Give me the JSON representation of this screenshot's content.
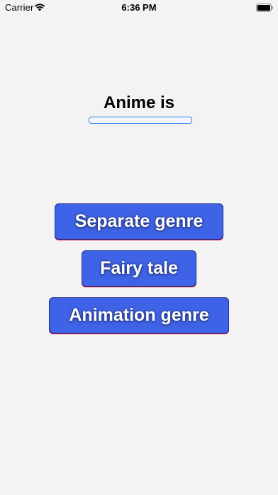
{
  "status_bar": {
    "carrier": "Carrier",
    "time": "6:36 PM",
    "wifi_icon": "wifi-icon",
    "battery_icon": "battery-icon"
  },
  "quiz": {
    "question": "Anime is",
    "answer_field_value": "",
    "options": [
      {
        "label": "Separate genre"
      },
      {
        "label": "Fairy tale"
      },
      {
        "label": "Animation genre"
      }
    ]
  },
  "colors": {
    "background": "#f3f3f3",
    "button_fill": "#3f63e6",
    "button_border": "#1c2e8a",
    "field_border": "#2f7ef2",
    "button_underline": "#d51b3a"
  }
}
